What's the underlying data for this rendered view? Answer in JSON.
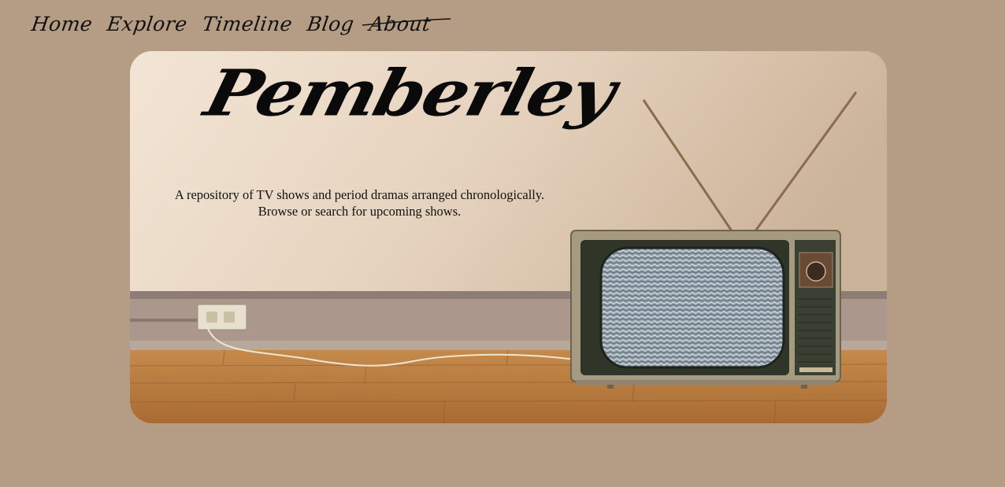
{
  "nav": {
    "items": [
      {
        "label": "Home"
      },
      {
        "label": "Explore"
      },
      {
        "label": "Timeline"
      },
      {
        "label": "Blog"
      },
      {
        "label": "About"
      }
    ]
  },
  "hero": {
    "title": "Pemberley",
    "description_line1": "A repository of TV shows and period dramas arranged chronologically.",
    "description_line2": "Browse or search for upcoming shows.",
    "image_subject": "vintage-television-on-wooden-floor"
  },
  "colors": {
    "page_background": "#b59c84",
    "wall_light": "#f1e3d3",
    "wall_dark": "#c8b096",
    "floor": "#b77a3e",
    "text": "#111111"
  }
}
